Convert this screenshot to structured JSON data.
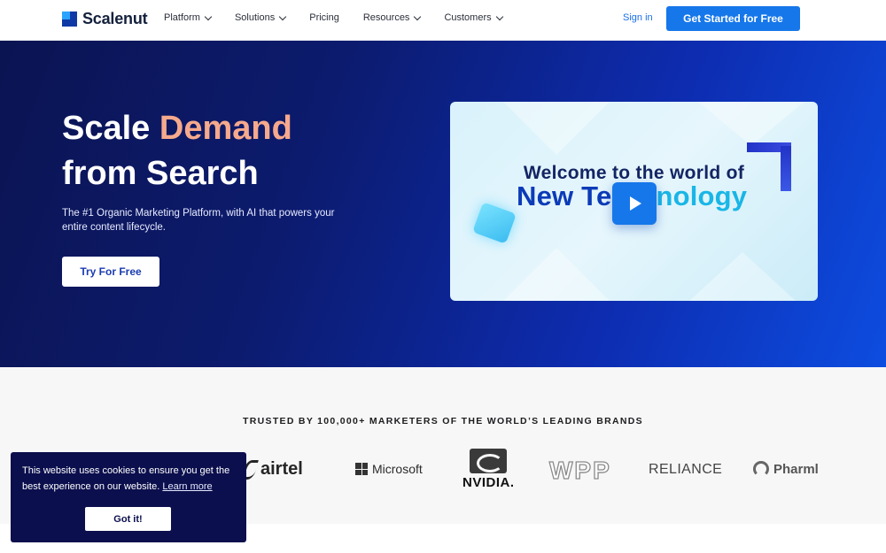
{
  "nav": {
    "brand": "Scalenut",
    "items": [
      {
        "label": "Platform",
        "dropdown": true
      },
      {
        "label": "Solutions",
        "dropdown": true
      },
      {
        "label": "Pricing",
        "dropdown": false
      },
      {
        "label": "Resources",
        "dropdown": true
      },
      {
        "label": "Customers",
        "dropdown": true
      }
    ],
    "signin": "Sign in",
    "cta": "Get Started for Free"
  },
  "hero": {
    "title_part1": "Scale ",
    "title_accent": "Demand",
    "title_line2": "from Search",
    "subtitle": "The #1 Organic Marketing Platform, with AI that powers your entire content lifecycle.",
    "cta": "Try For Free",
    "video": {
      "line1": "Welcome to the world of",
      "line2_a": "New Te",
      "line2_b": "nology",
      "play_icon": "play-icon"
    }
  },
  "trusted": {
    "title": "TRUSTED BY 100,000+ MARKETERS OF THE WORLD’S LEADING BRANDS",
    "brands": [
      "airtel",
      "Microsoft",
      "NVIDIA.",
      "WPP",
      "RELIANCE",
      "Pharml"
    ]
  },
  "cookie": {
    "text": "This website uses cookies to ensure you get the best experience on our website.",
    "link": "Learn more",
    "button": "Got it!"
  },
  "colors": {
    "primary": "#1677ea",
    "hero_bg_start": "#0b1452",
    "hero_bg_end": "#0d4de0",
    "accent": "#f6a98c",
    "cookie_bg": "#0b0f4d"
  }
}
